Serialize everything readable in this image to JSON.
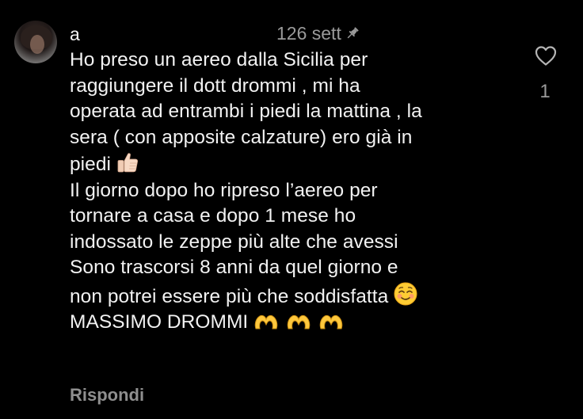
{
  "comment": {
    "username": "a",
    "timestamp": "126 sett",
    "pinned_icon": "pin-icon",
    "body_lines": [
      "Ho preso un aereo dalla Sicilia per",
      "raggiungere il dott drommi , mi ha",
      "operata ad entrambi i piedi  la mattina , la",
      "sera ( con apposite calzature) ero già in",
      "piedi",
      "Il giorno dopo ho ripreso l’aereo per",
      "tornare a casa e dopo 1 mese ho",
      "indossato le zeppe più alte che avessi",
      "Sono trascorsi 8 anni da quel giorno e",
      "non potrei essere più che soddisfatta",
      "MASSIMO DROMMI"
    ],
    "emojis": {
      "line_5": "thumbs-up-emoji",
      "line_10": "smiling-face-emoji",
      "line_11": "heart-hands-emoji x3"
    },
    "like_icon": "heart-outline-icon",
    "like_count": "1",
    "reply_label": "Rispondi"
  },
  "colors": {
    "background": "#000000",
    "primary_text": "#f2f2f2",
    "secondary_text": "#9a9a9a"
  }
}
